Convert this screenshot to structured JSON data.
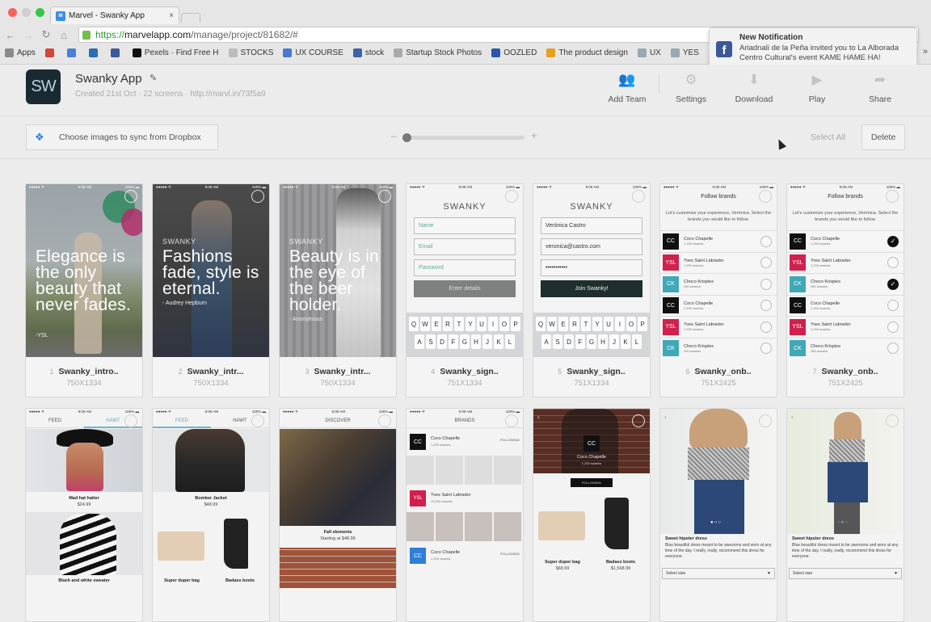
{
  "browser": {
    "tab_title": "Marvel - Swanky App",
    "tab_close": "×",
    "url_scheme": "https://",
    "url_host": "marvelapp.com",
    "url_path": "/manage/project/81682/#",
    "bookmarks": [
      {
        "label": "Apps",
        "icon": "apps-grid-icon",
        "color": "#8a8a8a"
      },
      {
        "label": "",
        "icon": "gmail-icon",
        "color": "#d14836"
      },
      {
        "label": "",
        "icon": "calendar-icon",
        "color": "#4a7fd6"
      },
      {
        "label": "",
        "icon": "trello-icon",
        "color": "#2a6db3"
      },
      {
        "label": "",
        "icon": "facebook-icon",
        "color": "#3b5998"
      },
      {
        "label": "Pexels · Find Free H",
        "icon": "pexels-icon",
        "color": "#111111"
      },
      {
        "label": "STOCKS",
        "icon": "stocks-icon",
        "color": "#bbbbbb"
      },
      {
        "label": "UX COURSE",
        "icon": "docs-icon",
        "color": "#4a78d0"
      },
      {
        "label": "stock",
        "icon": "stock-icon",
        "color": "#3d63a8"
      },
      {
        "label": "Startup Stock Photos",
        "icon": "ssp-icon",
        "color": "#aaaaaa"
      },
      {
        "label": "OOZLED",
        "icon": "oozled-icon",
        "color": "#2a56b0"
      },
      {
        "label": "The product design",
        "icon": "pinwheel-icon",
        "color": "#e6a020"
      },
      {
        "label": "UX",
        "icon": "folder-icon",
        "color": "#9aa6b0"
      },
      {
        "label": "YES",
        "icon": "folder-icon",
        "color": "#9aa6b0"
      }
    ],
    "more": "»"
  },
  "notification": {
    "title": "New Notification",
    "body": "Ariadnali de la Peña invited you to La Alborada Centro Cultural's event KAME HAME HA!"
  },
  "project": {
    "logo_text": "SW",
    "name": "Swanky App",
    "meta": "Created 21st Oct · 22 screens · http://marvl.in/73f5a9"
  },
  "actions": [
    {
      "label": "Add Team",
      "icon": "add-team-icon",
      "glyph": "👥"
    },
    {
      "label": "Settings",
      "icon": "gear-icon",
      "glyph": "⚙"
    },
    {
      "label": "Download",
      "icon": "download-icon",
      "glyph": "⬇"
    },
    {
      "label": "Play",
      "icon": "play-icon",
      "glyph": "▶"
    },
    {
      "label": "Share",
      "icon": "share-icon",
      "glyph": "➦"
    }
  ],
  "toolbar": {
    "dropbox_label": "Choose images to sync from Dropbox",
    "zoom_level": 0.0,
    "zoom_minus": "–",
    "zoom_plus": "+",
    "select_all": "Select All",
    "delete": "Delete"
  },
  "screens": [
    {
      "num": "1",
      "title": "Swanky_intro..",
      "size": "750X1334",
      "quote": "Elegance is the only beauty that never fades.",
      "attribution": "-YSL",
      "brand": ""
    },
    {
      "num": "2",
      "title": "Swanky_intr...",
      "size": "750X1334",
      "quote": "Fashions fade, style is eternal.",
      "attribution": "- Audrey Hepburn",
      "brand": "SWANKY"
    },
    {
      "num": "3",
      "title": "Swanky_intr...",
      "size": "750X1334",
      "quote": "Beauty is in the eye of the beer holder.",
      "attribution": "- Anonymous",
      "brand": "SWANKY"
    },
    {
      "num": "4",
      "title": "Swanky_sign..",
      "size": "751X1334",
      "logo": "SWANKY",
      "fields": [
        "Name",
        "Email",
        "Password"
      ],
      "button": "Enter details"
    },
    {
      "num": "5",
      "title": "Swanky_sign..",
      "size": "751X1334",
      "logo": "SWANKY",
      "fields": [
        "Verónica Castro",
        "veronica@castro.com",
        "•••••••••••"
      ],
      "button": "Join Swanky!"
    },
    {
      "num": "6",
      "title": "Swanky_onb..",
      "size": "751X2425",
      "heading": "Follow brands",
      "desc": "Let's customize your experience, Verónica. Select the brands you would like to follow."
    },
    {
      "num": "7",
      "title": "Swanky_onb..",
      "size": "751X2425",
      "heading": "Follow brands",
      "desc": "Let's customize your experience, Verónica. Select the brands you would like to follow."
    }
  ],
  "brands": [
    {
      "name": "Coco Chapelle",
      "count": "1,200 swanks",
      "color": "#111111",
      "mark": "CC"
    },
    {
      "name": "Yves Saint Labrador",
      "count": "1,200 swanks",
      "color": "#d21f4e",
      "mark": "YSL"
    },
    {
      "name": "Choco Krispies",
      "count": "280 swanks",
      "color": "#3fa9b8",
      "mark": "CK"
    },
    {
      "name": "Coco Chapelle",
      "count": "1,200 swanks",
      "color": "#111111",
      "mark": "CC"
    },
    {
      "name": "Yves Saint Labrador",
      "count": "1,200 swanks",
      "color": "#d21f4e",
      "mark": "YSL"
    },
    {
      "name": "Choco Krispies",
      "count": "280 swanks",
      "color": "#3fa9b8",
      "mark": "CK"
    }
  ],
  "screen7_checked": [
    true,
    false,
    true,
    false,
    false,
    false
  ],
  "keyboard": {
    "row1": [
      "Q",
      "W",
      "E",
      "R",
      "T",
      "Y",
      "U",
      "I",
      "O",
      "P"
    ],
    "row2": [
      "A",
      "S",
      "D",
      "F",
      "G",
      "H",
      "J",
      "K",
      "L"
    ]
  },
  "row2": {
    "feed_tab": "FEED",
    "hawt_tab": "HAWT",
    "discover_tab": "DISCOVER",
    "brands_tab": "BRANDS",
    "following": "FOLLOWING",
    "s8_item1": "Mad hat hatter",
    "s8_price1": "$24.99",
    "s8_item2": "Black and white sweater",
    "s9_item1": "Bomber Jacket",
    "s9_price1": "$48.99",
    "s9_item2": "Super duper bag",
    "s9_item3": "Badass boots",
    "s10_item1": "Fall elements",
    "s10_price1": "Starting at $48.99",
    "s11_brand1": "Coco Chapelle",
    "s11_count1": "1,200 swanks",
    "s11_brand2": "Yves Saint Labrador",
    "s11_count2": "12,200 swanks",
    "s11_brand3": "Coco Chapelle",
    "s11_count3": "1,200 swanks",
    "s12_brand": "Coco Chapelle",
    "s12_count": "1,200 swanks",
    "s12_item1": "Super duper bag",
    "s12_price1": "$68.99",
    "s12_item2": "Badass boots",
    "s12_price2": "$1,568.99",
    "dress_title": "Sweet hipster dress",
    "dress_desc": "Blue beautiful dress meant to be awesome and worn at any time of the day. I really, really, recommend this dress for everyone.",
    "select_size": "Select size"
  }
}
